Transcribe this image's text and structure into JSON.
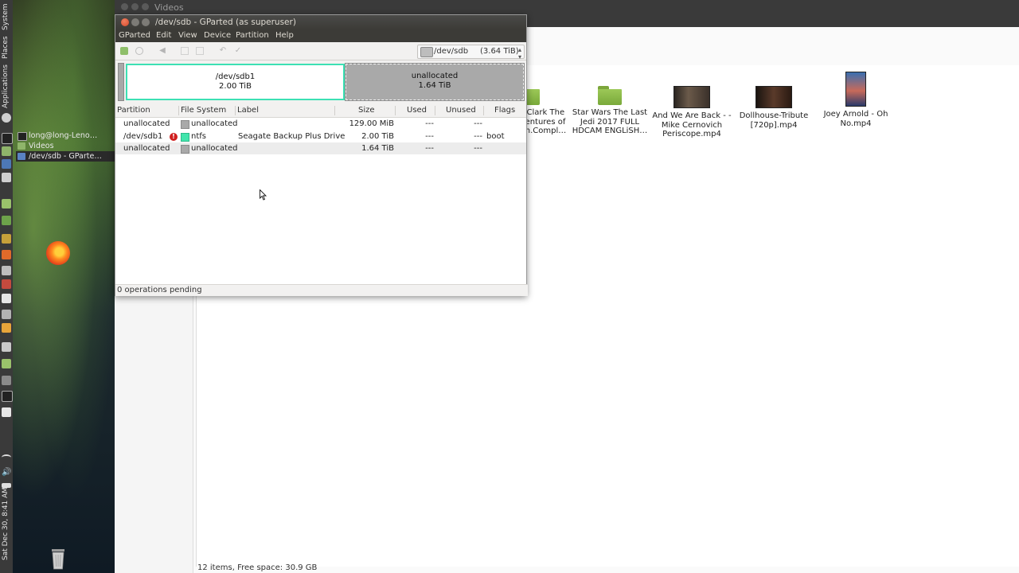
{
  "vertical_panel": {
    "system": "System",
    "places": "Places",
    "applications": "Applications",
    "clock": "Sat Dec 30,  8:41 AM"
  },
  "tasklist": [
    {
      "label": "long@long-Leno…"
    },
    {
      "label": "Videos"
    },
    {
      "label": "/dev/sdb - GParte…"
    }
  ],
  "file_manager": {
    "title": "Videos",
    "status": "12 items, Free space: 30.9 GB",
    "items": [
      {
        "type": "folder",
        "name": "Lois and Clark The New Adventures of Superman.Compl…"
      },
      {
        "type": "folder",
        "name": "Star Wars The Last Jedi 2017 FULL HDCAM ENGLiSH…"
      },
      {
        "type": "video",
        "name": "And We Are Back - - Mike Cernovich Periscope.mp4"
      },
      {
        "type": "video",
        "name": "Dollhouse-Tribute [720p].mp4"
      },
      {
        "type": "video",
        "name": "Joey Arnold - Oh No.mp4"
      }
    ]
  },
  "gparted": {
    "title": "/dev/sdb - GParted (as superuser)",
    "menu": [
      "GParted",
      "Edit",
      "View",
      "Device",
      "Partition",
      "Help"
    ],
    "device": {
      "name": "/dev/sdb",
      "size": "(3.64 TiB)"
    },
    "graphic": {
      "sdb1": {
        "name": "/dev/sdb1",
        "size": "2.00 TiB"
      },
      "unallocated": {
        "name": "unallocated",
        "size": "1.64 TiB"
      }
    },
    "columns": [
      "Partition",
      "File System",
      "Label",
      "Size",
      "Used",
      "Unused",
      "Flags"
    ],
    "rows": [
      {
        "partition": "unallocated",
        "fs": "unallocated",
        "fs_color": "#a9a9a9",
        "label": "",
        "size": "129.00 MiB",
        "used": "---",
        "unused": "---",
        "flags": ""
      },
      {
        "partition": "/dev/sdb1",
        "fs": "ntfs",
        "fs_color": "#42e5ac",
        "label": "Seagate Backup Plus Drive",
        "size": "2.00 TiB",
        "used": "---",
        "unused": "---",
        "flags": "boot"
      },
      {
        "partition": "unallocated",
        "fs": "unallocated",
        "fs_color": "#a9a9a9",
        "label": "",
        "size": "1.64 TiB",
        "used": "---",
        "unused": "---",
        "flags": ""
      }
    ],
    "status": "0 operations pending"
  },
  "colors": {
    "sdb1_border": "#3de0b4",
    "ntfs": "#42e5ac",
    "unallocated": "#a9a9a9",
    "warning": "#d01f1f"
  }
}
